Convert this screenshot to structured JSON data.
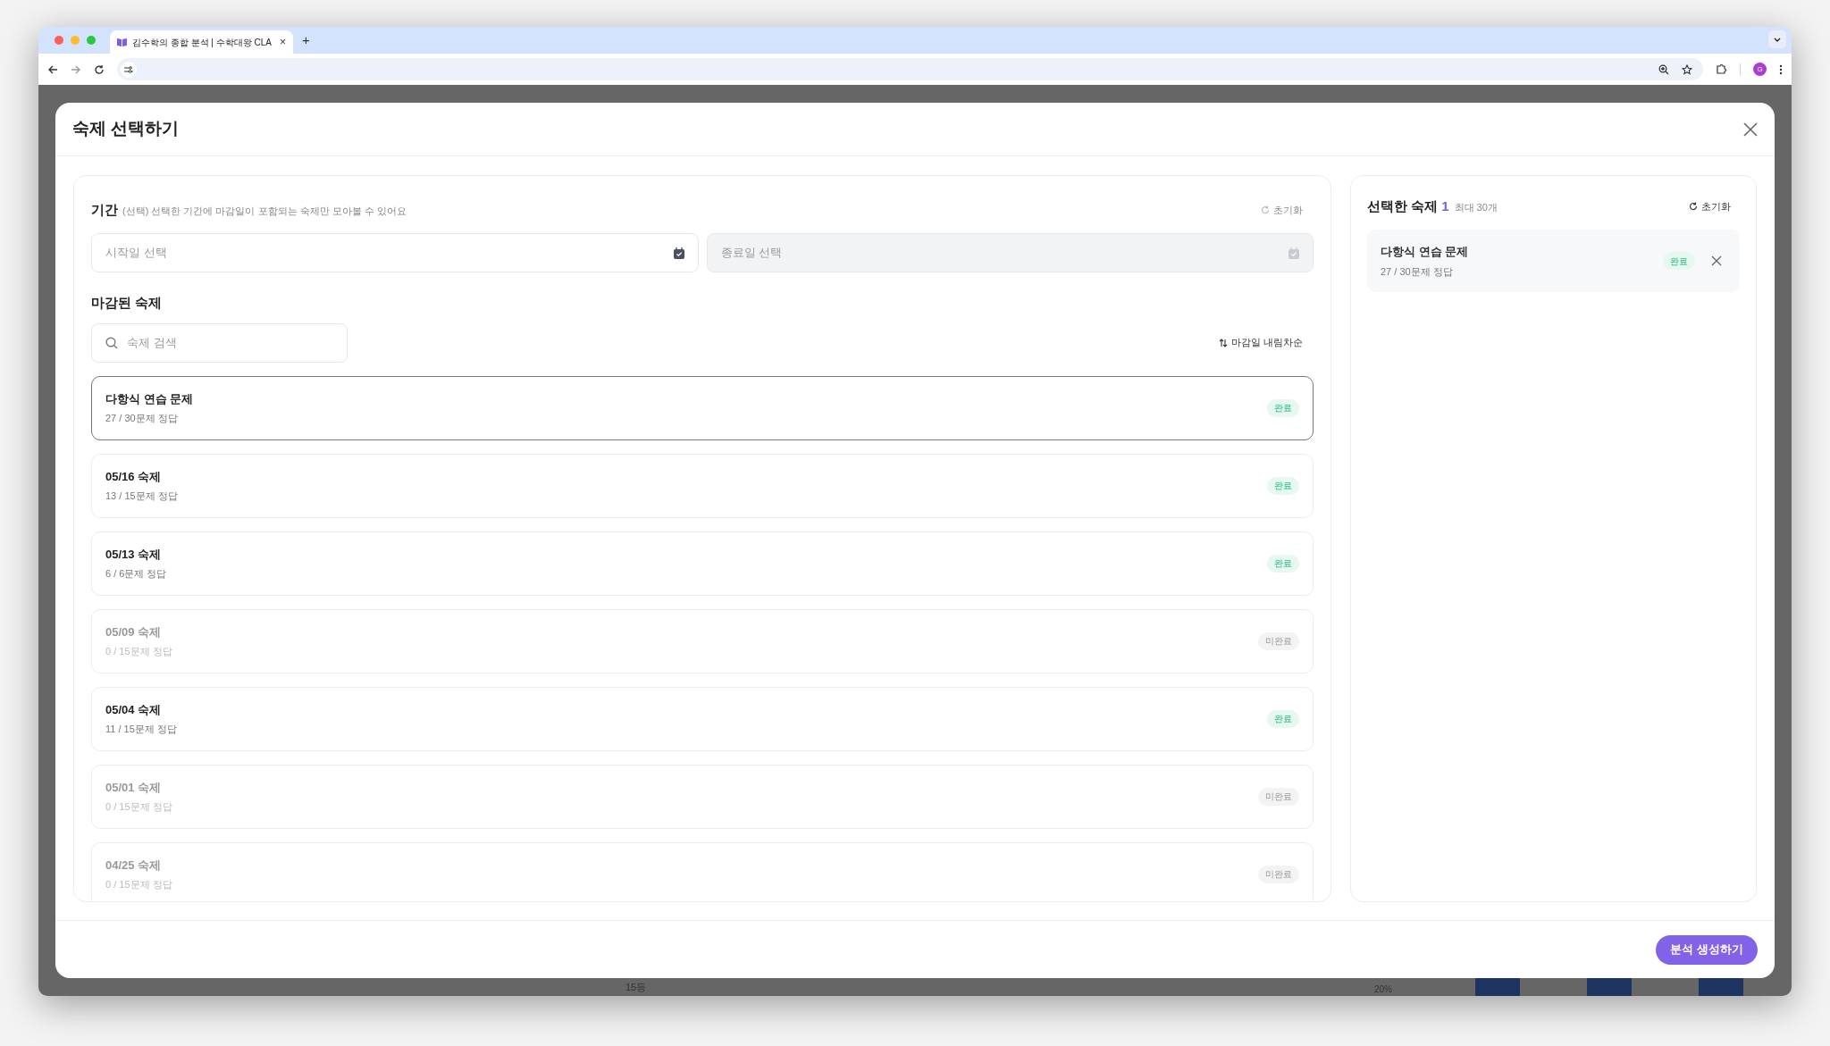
{
  "browser": {
    "tab_title": "김수학의 종합 분석 | 수학대왕 CLA",
    "tab_close": "×",
    "new_tab": "+",
    "profile_initial": "G"
  },
  "background": {
    "rank_label": "15등",
    "percent_label": "20%"
  },
  "dialog": {
    "title": "숙제 선택하기",
    "period": {
      "label": "기간",
      "hint": "(선택) 선택한 기간에 마감일이 포함되는 숙제만 모아볼 수 있어요",
      "reset": "초기화",
      "reset_disabled": true,
      "start": {
        "placeholder": "시작일 선택",
        "disabled": false
      },
      "end": {
        "placeholder": "종료일 선택",
        "disabled": true
      }
    },
    "closed_label": "마감된 숙제",
    "search": {
      "placeholder": "숙제 검색"
    },
    "sort": "마감일 내림차순",
    "homeworks": [
      {
        "title": "다항식 연습 문제",
        "score": "27 / 30문제 정답",
        "status": "완료",
        "kind": "done",
        "selected": true
      },
      {
        "title": "05/16 숙제",
        "score": "13 / 15문제 정답",
        "status": "완료",
        "kind": "done",
        "selected": false
      },
      {
        "title": "05/13 숙제",
        "score": "6 / 6문제 정답",
        "status": "완료",
        "kind": "done",
        "selected": false
      },
      {
        "title": "05/09 숙제",
        "score": "0 / 15문제 정답",
        "status": "미완료",
        "kind": "todo",
        "selected": false
      },
      {
        "title": "05/04 숙제",
        "score": "11 / 15문제 정답",
        "status": "완료",
        "kind": "done",
        "selected": false
      },
      {
        "title": "05/01 숙제",
        "score": "0 / 15문제 정답",
        "status": "미완료",
        "kind": "todo",
        "selected": false
      },
      {
        "title": "04/25 숙제",
        "score": "0 / 15문제 정답",
        "status": "미완료",
        "kind": "todo",
        "selected": false
      }
    ],
    "selected_panel": {
      "label": "선택한 숙제",
      "count": "1",
      "limit": "최대 30개",
      "reset": "초기화",
      "items": [
        {
          "title": "다항식 연습 문제",
          "score": "27 / 30문제 정답",
          "status": "완료",
          "kind": "done"
        }
      ]
    },
    "submit": "분석 생성하기"
  }
}
